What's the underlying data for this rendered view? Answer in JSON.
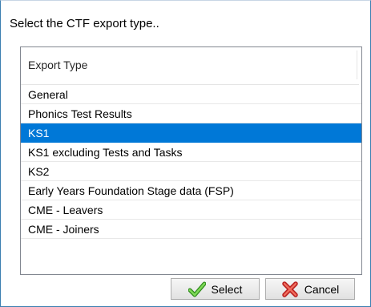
{
  "dialog": {
    "prompt": "Select the CTF export type.."
  },
  "list": {
    "column_header": "Export Type",
    "items": [
      "General",
      "Phonics Test Results",
      "KS1",
      "KS1 excluding Tests and Tasks",
      "KS2",
      "Early Years Foundation Stage data (FSP)",
      "CME - Leavers",
      "CME - Joiners"
    ],
    "selected_item": "KS1"
  },
  "buttons": {
    "select_label": "Select",
    "select_icon": "green-checkmark-icon",
    "cancel_label": "Cancel",
    "cancel_icon": "red-x-icon"
  },
  "colors": {
    "selection": "#0078d7",
    "check": "#4caf2e",
    "cancel_x": "#e03a2f"
  }
}
